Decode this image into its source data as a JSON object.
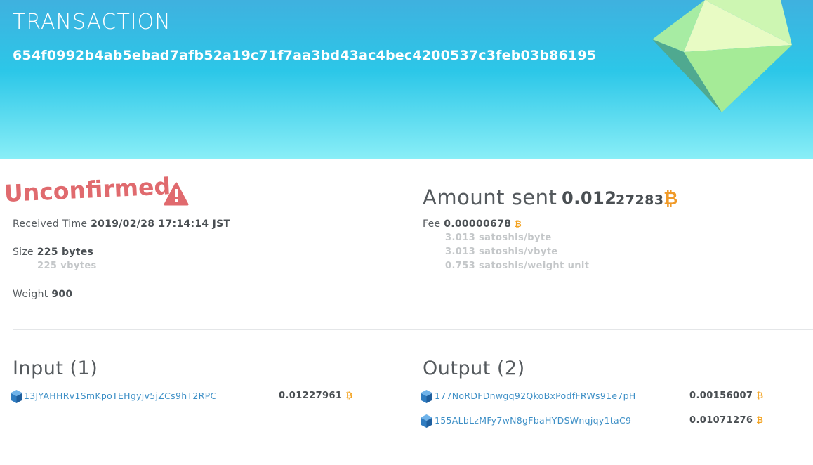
{
  "header": {
    "title": "TRANSACTION",
    "txid": "654f0992b4ab5ebad7afb52a19c71f7aa3bd43ac4bec4200537c3feb03b86195"
  },
  "colors": {
    "header_gradient_top": "#3fb1df",
    "header_gradient_bottom": "#89eef7",
    "unconfirmed": "#e06a6e",
    "bitcoin": "#f3a321",
    "link": "#3d8fc6",
    "muted": "#c4c7c9"
  },
  "status": {
    "label": "Unconfirmed",
    "icon": "warning-triangle-icon"
  },
  "details": {
    "received_label": "Received Time",
    "received_value": "2019/02/28 17:14:14 JST",
    "size_label": "Size",
    "size_value": "225 bytes",
    "size_vbytes": "225 vbytes",
    "weight_label": "Weight",
    "weight_value": "900"
  },
  "amount": {
    "label": "Amount sent",
    "value_main": "0.012",
    "value_tail": "27283",
    "currency_symbol": "₿",
    "fee_label": "Fee",
    "fee_value": "0.00000678",
    "rates": [
      "3.013 satoshis/byte",
      "3.013 satoshis/vbyte",
      "0.753 satoshis/weight unit"
    ]
  },
  "inputs": {
    "title": "Input (1)",
    "items": [
      {
        "address": "13JYAHHRv1SmKpoTEHgyjv5jZCs9hT2RPC",
        "value": "0.01227961"
      }
    ]
  },
  "outputs": {
    "title": "Output (2)",
    "items": [
      {
        "address": "177NoRDFDnwgq92QkoBxPodfFRWs91e7pH",
        "value": "0.00156007"
      },
      {
        "address": "155ALbLzMFy7wN8gFbaHYDSWnqjqy1taC9",
        "value": "0.01071276"
      }
    ]
  }
}
